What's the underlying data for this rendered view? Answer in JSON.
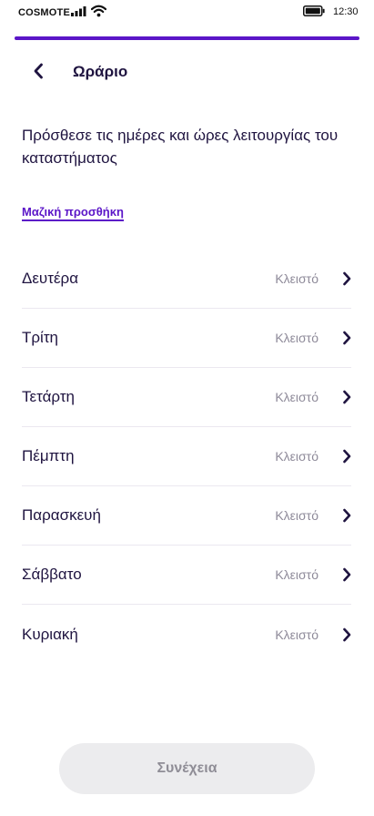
{
  "status_bar": {
    "carrier": "COSMOTE",
    "time": "12:30",
    "icons": [
      "signal-icon",
      "wifi-icon",
      "battery-icon"
    ]
  },
  "progress": {
    "fraction": 1.0,
    "color": "#5b16c8"
  },
  "header": {
    "back_icon": "chevron-left-icon",
    "title": "Ωράριο"
  },
  "main": {
    "description": "Πρόσθεσε τις ημέρες και ώρες λειτουργίας του καταστήματος",
    "bulk_add_label": "Μαζική προσθήκη",
    "days": [
      {
        "name": "Δευτέρα",
        "status": "Κλειστό"
      },
      {
        "name": "Τρίτη",
        "status": "Κλειστό"
      },
      {
        "name": "Τετάρτη",
        "status": "Κλειστό"
      },
      {
        "name": "Πέμπτη",
        "status": "Κλειστό"
      },
      {
        "name": "Παρασκευή",
        "status": "Κλειστό"
      },
      {
        "name": "Σάββατο",
        "status": "Κλειστό"
      },
      {
        "name": "Κυριακή",
        "status": "Κλειστό"
      }
    ]
  },
  "footer": {
    "continue_label": "Συνέχεια",
    "continue_enabled": false
  },
  "colors": {
    "accent": "#5b16c8",
    "text_primary": "#1f1440",
    "text_muted": "#8e8a99",
    "button_disabled_bg": "#ececee"
  }
}
